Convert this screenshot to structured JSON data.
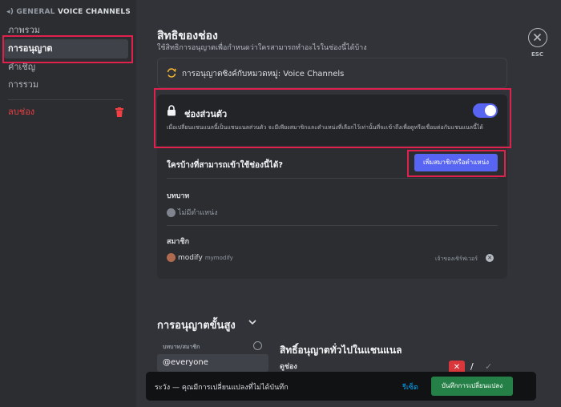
{
  "sidebar": {
    "header_prefix": "GENERAL",
    "header_channels": "VOICE CHANNELS",
    "items": [
      {
        "label": "ภาพรวม"
      },
      {
        "label": "การอนุญาต"
      },
      {
        "label": "คำเชิญ"
      },
      {
        "label": "การรวม"
      }
    ],
    "delete_label": "ลบช่อง"
  },
  "header": {
    "title": "สิทธิของช่อง",
    "subtitle": "ใช้สิทธิการอนุญาตเพื่อกำหนดว่าใครสามารถทำอะไรในช่องนี้ได้บ้าง",
    "esc_label": "ESC"
  },
  "sync": {
    "text": "การอนุญาตซิงค์กับหมวดหมู่: Voice Channels"
  },
  "private": {
    "title": "ช่องส่วนตัว",
    "description": "เมื่อเปลี่ยนแชนแนลนี้เป็นแชนแนลส่วนตัว จะมีเพียงสมาชิกและตำแหน่งที่เลือกไว้เท่านั้นที่จะเข้าถึงเพื่อดูหรือเชื่อมต่อกับแชนแนลนี้ได้",
    "toggle_on": true
  },
  "access": {
    "question": "ใครบ้างที่สามารถเข้าใช้ช่องนี้ได้?",
    "add_button": "เพิ่มสมาชิกหรือตำแหน่ง",
    "roles_label": "บทบาท",
    "no_roles": "ไม่มีตำแหน่ง",
    "members_label": "สมาชิก",
    "member_name": "modify",
    "member_handle": "mymodify",
    "owner_label": "เจ้าของเซิร์ฟเวอร์"
  },
  "advanced": {
    "title": "การอนุญาตขั้นสูง",
    "roles_members_label": "บทบาท/สมาชิก",
    "everyone": "@everyone",
    "general_title": "สิทธิ์อนุญาตทั่วไปในแชนแนล",
    "view_channel": "ดูช่อง",
    "deny_symbol": "✕",
    "neutral_symbol": "/",
    "allow_symbol": "✓"
  },
  "unsaved": {
    "warning": "ระวัง — คุณมีการเปลี่ยนแปลงที่ไม่ได้บันทึก",
    "reset": "รีเซ็ต",
    "save": "บันทึกการเปลี่ยนแปลง"
  },
  "colors": {
    "accent": "#5865f2",
    "highlight": "#e0214d",
    "danger": "#da373c",
    "save": "#248046"
  }
}
